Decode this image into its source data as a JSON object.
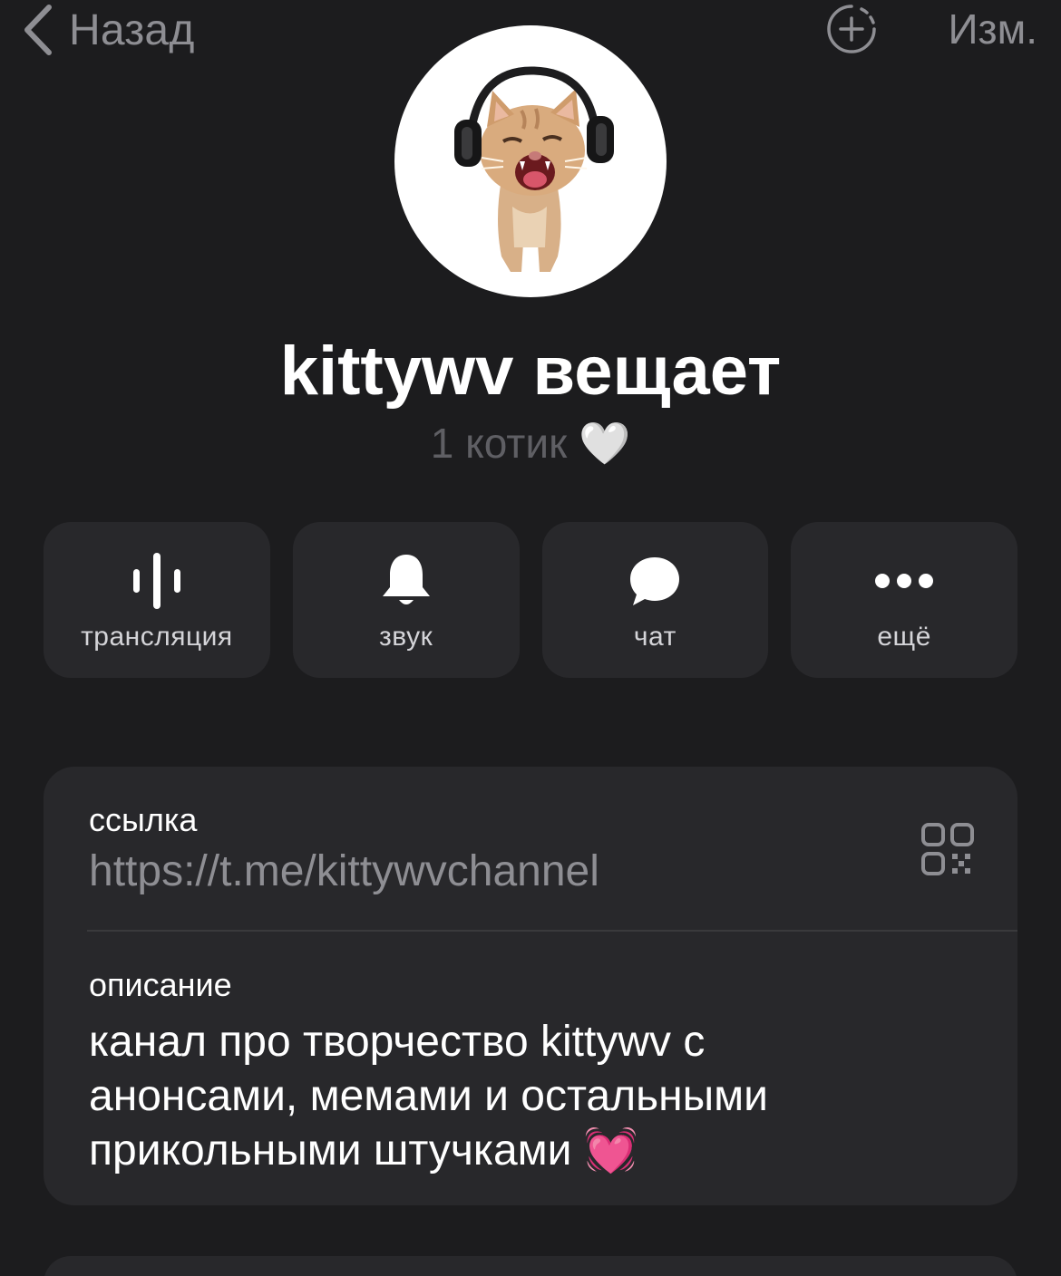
{
  "nav": {
    "back_label": "Назад",
    "edit_label": "Изм."
  },
  "channel": {
    "title": "kittywv вещает",
    "subscribers": "1 котик 🤍"
  },
  "actions": [
    {
      "label": "трансляция",
      "icon": "voice-wave-icon"
    },
    {
      "label": "звук",
      "icon": "bell-icon"
    },
    {
      "label": "чат",
      "icon": "chat-bubble-icon"
    },
    {
      "label": "ещё",
      "icon": "more-dots-icon"
    }
  ],
  "info": {
    "link_label": "ссылка",
    "link_value": "https://t.me/kittywvchannel",
    "description_label": "описание",
    "description_lines": [
      "канал про творчество kittywv с",
      "анонсами, мемами и остальными",
      "прикольными штучками 💓"
    ]
  },
  "colors": {
    "background": "#1c1c1e",
    "card": "#28282b",
    "muted_text": "#8e8e93",
    "primary_text": "#ffffff"
  }
}
